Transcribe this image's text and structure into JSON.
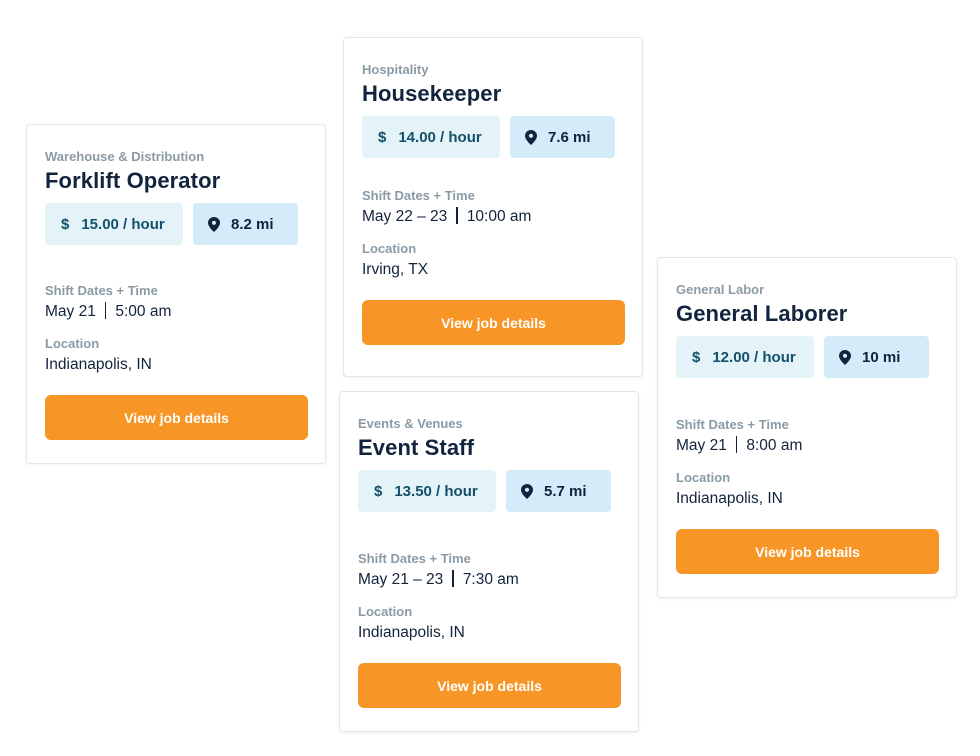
{
  "colors": {
    "accent": "#f79626",
    "title": "#12233d",
    "muted": "#8a9ba6",
    "pay_bg": "#e3f3f8",
    "distance_bg": "#d4ecf9"
  },
  "jobs": [
    {
      "category": "Warehouse & Distribution",
      "title": "Forklift Operator",
      "pay": "15.00 / hour",
      "distance": "8.2 mi",
      "shift_label": "Shift Dates + Time",
      "shift_dates": "May 21",
      "shift_time": "5:00 am",
      "location_label": "Location",
      "location": "Indianapolis, IN",
      "button": "View job details"
    },
    {
      "category": "Hospitality",
      "title": "Housekeeper",
      "pay": "14.00 / hour",
      "distance": "7.6 mi",
      "shift_label": "Shift Dates + Time",
      "shift_dates": "May 22 – 23",
      "shift_time": "10:00 am",
      "location_label": "Location",
      "location": "Irving, TX",
      "button": "View job details"
    },
    {
      "category": "Events & Venues",
      "title": "Event Staff",
      "pay": "13.50 / hour",
      "distance": "5.7 mi",
      "shift_label": "Shift Dates + Time",
      "shift_dates": "May 21 – 23",
      "shift_time": "7:30 am",
      "location_label": "Location",
      "location": "Indianapolis, IN",
      "button": "View job details"
    },
    {
      "category": "General Labor",
      "title": "General Laborer",
      "pay": "12.00 / hour",
      "distance": "10 mi",
      "shift_label": "Shift Dates + Time",
      "shift_dates": "May 21",
      "shift_time": "8:00 am",
      "location_label": "Location",
      "location": "Indianapolis, IN",
      "button": "View job details"
    }
  ],
  "icons": {
    "pay": "dollar-icon",
    "distance": "map-pin-icon"
  },
  "currency_symbol": "$"
}
